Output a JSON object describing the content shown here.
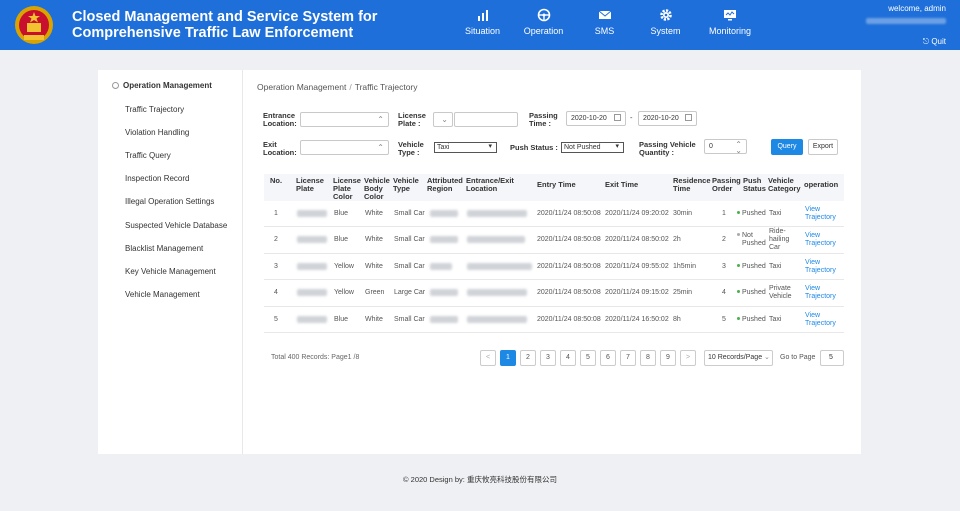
{
  "header": {
    "title_line1": "Closed Management and Service System for",
    "title_line2": "Comprehensive Traffic Law Enforcement",
    "nav": [
      {
        "label": "Situation",
        "icon": "bar-chart-icon"
      },
      {
        "label": "Operation",
        "icon": "steering-wheel-icon"
      },
      {
        "label": "SMS",
        "icon": "envelope-icon"
      },
      {
        "label": "System",
        "icon": "gear-icon"
      },
      {
        "label": "Monitoring",
        "icon": "monitor-icon"
      }
    ],
    "welcome": "welcome, admin",
    "quit": "Quit",
    "accent_color": "#1e6fd9"
  },
  "sidebar": {
    "heading": "Operation Management",
    "items": [
      "Traffic Trajectory",
      "Violation Handling",
      "Traffic Query",
      "Inspection Record",
      "Illegal Operation Settings",
      "Suspected Vehicle Database",
      "Blacklist Management",
      "Key Vehicle Management",
      "Vehicle Management"
    ]
  },
  "breadcrumb": {
    "parent": "Operation Management",
    "sep": "/",
    "current": "Traffic Trajectory"
  },
  "filters": {
    "entrance_label_1": "Entrance",
    "entrance_label_2": "Location:",
    "plate_label_1": "License",
    "plate_label_2": "Plate :",
    "passing_time_label_1": "Passing",
    "passing_time_label_2": "Time :",
    "date_from": "2020-10-20",
    "date_sep": "-",
    "date_to": "2020-10-20",
    "exit_label_1": "Exit",
    "exit_label_2": "Location:",
    "vtype_label_1": "Vehicle",
    "vtype_label_2": "Type :",
    "vtype_value": "Taxi",
    "push_label": "Push Status :",
    "push_value": "Not Pushed",
    "qty_label_1": "Passing Vehicle",
    "qty_label_2": "Quantity :",
    "qty_value": "0",
    "query": "Query",
    "export": "Export"
  },
  "table": {
    "headers": {
      "no": "No.",
      "plate_1": "License",
      "plate_2": "Plate",
      "pcolor_1": "License",
      "pcolor_2": "Plate",
      "pcolor_3": "Color",
      "bcolor_1": "Vehicle",
      "bcolor_2": "Body",
      "bcolor_3": "Color",
      "vtype_1": "Vehicle",
      "vtype_2": "Type",
      "region_1": "Attributed",
      "region_2": "Region",
      "loc_1": "Entrance/Exit",
      "loc_2": "Location",
      "entry": "Entry Time",
      "exit": "Exit Time",
      "res_1": "Residence",
      "res_2": "Time",
      "order_1": "Passing",
      "order_2": "Order",
      "push_1": "Push",
      "push_2": "Status",
      "cat_1": "Vehicle",
      "cat_2": "Category",
      "op": "operation"
    },
    "rows": [
      {
        "no": "1",
        "pcolor": "Blue",
        "bcolor": "White",
        "vtype": "Small Car",
        "entry": "2020/11/24 08:50:08",
        "exit": "2020/11/24 09:20:02",
        "res": "30min",
        "order": "1",
        "push_1": "Pushed",
        "push_2": "",
        "cat_1": "Taxi",
        "cat_2": "",
        "cat_3": "",
        "op_1": "View",
        "op_2": "Trajectory"
      },
      {
        "no": "2",
        "pcolor": "Blue",
        "bcolor": "White",
        "vtype": "Small Car",
        "entry": "2020/11/24 08:50:08",
        "exit": "2020/11/24 08:50:02",
        "res": "2h",
        "order": "2",
        "push_1": "Not",
        "push_2": "Pushed",
        "cat_1": "Ride-",
        "cat_2": "hailing",
        "cat_3": "Car",
        "op_1": "View",
        "op_2": "Trajectory"
      },
      {
        "no": "3",
        "pcolor": "Yellow",
        "bcolor": "White",
        "vtype": "Small Car",
        "entry": "2020/11/24 08:50:08",
        "exit": "2020/11/24 09:55:02",
        "res": "1h5min",
        "order": "3",
        "push_1": "Pushed",
        "push_2": "",
        "cat_1": "Taxi",
        "cat_2": "",
        "cat_3": "",
        "op_1": "View",
        "op_2": "Trajectory"
      },
      {
        "no": "4",
        "pcolor": "Yellow",
        "bcolor": "Green",
        "vtype": "Large Car",
        "entry": "2020/11/24 08:50:08",
        "exit": "2020/11/24 09:15:02",
        "res": "25min",
        "order": "4",
        "push_1": "Pushed",
        "push_2": "",
        "cat_1": "Private",
        "cat_2": "Vehicle",
        "cat_3": "",
        "op_1": "View",
        "op_2": "Trajectory"
      },
      {
        "no": "5",
        "pcolor": "Blue",
        "bcolor": "White",
        "vtype": "Small Car",
        "entry": "2020/11/24 08:50:08",
        "exit": "2020/11/24 16:50:02",
        "res": "8h",
        "order": "5",
        "push_1": "Pushed",
        "push_2": "",
        "cat_1": "Taxi",
        "cat_2": "",
        "cat_3": "",
        "op_1": "View",
        "op_2": "Trajectory"
      }
    ]
  },
  "pagination": {
    "total": "Total 400 Records: Page1 /8",
    "prev": "<",
    "pages": [
      "1",
      "2",
      "3",
      "4",
      "5",
      "6",
      "7",
      "8",
      "9"
    ],
    "next": ">",
    "page_size": "10 Records/Page",
    "goto_label": "Go to Page",
    "goto_value": "5"
  },
  "footer": "© 2020 Design by: 重庆攸亮科技股份有限公司"
}
